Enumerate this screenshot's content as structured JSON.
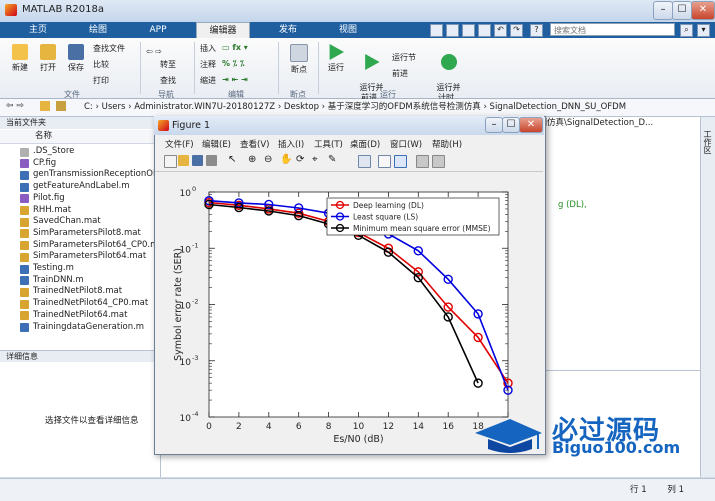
{
  "window": {
    "title": "MATLAB R2018a",
    "controls": [
      "–",
      "☐",
      "✕"
    ]
  },
  "ribbon_tabs": [
    "主页",
    "绘图",
    "APP",
    "编辑器",
    "发布",
    "视图"
  ],
  "search": {
    "placeholder": "搜索文档"
  },
  "ribbon": {
    "new": "新建",
    "open": "打开",
    "save": "保存",
    "find_files": "查找文件",
    "compare": "比较",
    "print": "打印",
    "goto": "转至",
    "find": "查找",
    "insert": "插入",
    "comment": "注释",
    "indent": "缩进",
    "breakpoints": "断点",
    "run": "运行",
    "run_advance": "运行并\n前进",
    "run_section": "运行节",
    "advance": "前进",
    "run_time": "运行并\n计时",
    "groups": {
      "file": "文件",
      "navigate": "导航",
      "edit": "编辑",
      "breakpoints": "断点",
      "run": "运行"
    }
  },
  "address": {
    "path": "C: › Users › Administrator.WIN7U-20180127Z › Desktop › 基于深度学习的OFDM系统信号检测仿真 › SignalDetection_DNN_SU_OFDM"
  },
  "left_panel": {
    "title": "当前文件夹",
    "column": "名称",
    "files": [
      ".DS_Store",
      "CP.fig",
      "genTransmissionReceptionOFDM.m",
      "getFeatureAndLabel.m",
      "Pilot.fig",
      "RHH.mat",
      "SavedChan.mat",
      "SimParametersPilot8.mat",
      "SimParametersPilot64_CP0.mat",
      "SimParametersPilot64.mat",
      "Testing.m",
      "TrainDNN.m",
      "TrainedNetPilot8.mat",
      "TrainedNetPilot64_CP0.mat",
      "TrainedNetPilot64.mat",
      "TrainingdataGeneration.m"
    ],
    "details_title": "详细信息",
    "details_hint": "选择文件以查看详细信息"
  },
  "editor": {
    "path_tail": "检测仿真\\SignalDetection_D...",
    "code_fragment": "g (DL),"
  },
  "workspace_label": "工作区",
  "status": {
    "row_label": "行",
    "row": "1",
    "col_label": "列",
    "col": "1"
  },
  "figure": {
    "title": "Figure 1",
    "menu": [
      "文件(F)",
      "编辑(E)",
      "查看(V)",
      "插入(I)",
      "工具(T)",
      "桌面(D)",
      "窗口(W)",
      "帮助(H)"
    ]
  },
  "chart_data": {
    "type": "line",
    "xlabel": "Es/N0 (dB)",
    "ylabel": "Symbol error rate (SER)",
    "xlim": [
      0,
      20
    ],
    "ylim": [
      0.0001,
      1
    ],
    "yscale": "log",
    "xticks": [
      0,
      2,
      4,
      6,
      8,
      10,
      12,
      14,
      16,
      18,
      20
    ],
    "yticks": [
      0.0001,
      0.001,
      0.01,
      0.1,
      1
    ],
    "ytick_labels": [
      [
        "10",
        "-4"
      ],
      [
        "10",
        "-3"
      ],
      [
        "10",
        "-2"
      ],
      [
        "10",
        "-1"
      ],
      [
        "10",
        "0"
      ]
    ],
    "legend_position": "top-right",
    "series": [
      {
        "name": "Deep learning (DL)",
        "color": "#e00000",
        "x": [
          0,
          2,
          4,
          6,
          8,
          10,
          12,
          14,
          16,
          18,
          20
        ],
        "y": [
          0.65,
          0.58,
          0.5,
          0.42,
          0.3,
          0.19,
          0.1,
          0.038,
          0.009,
          0.0026,
          0.0004
        ]
      },
      {
        "name": "Least square (LS)",
        "color": "#0000e0",
        "x": [
          0,
          2,
          4,
          6,
          8,
          10,
          12,
          14,
          16,
          18,
          20
        ],
        "y": [
          0.7,
          0.64,
          0.6,
          0.52,
          0.42,
          0.3,
          0.18,
          0.09,
          0.028,
          0.0068,
          0.0003
        ]
      },
      {
        "name": "Minimum mean square error (MMSE)",
        "color": "#000000",
        "x": [
          0,
          2,
          4,
          6,
          8,
          10,
          12,
          14,
          16,
          18
        ],
        "y": [
          0.6,
          0.53,
          0.46,
          0.38,
          0.27,
          0.17,
          0.085,
          0.03,
          0.006,
          0.0004
        ]
      }
    ]
  },
  "watermark": {
    "text": "必过源码",
    "url": "Biguo100.com"
  }
}
